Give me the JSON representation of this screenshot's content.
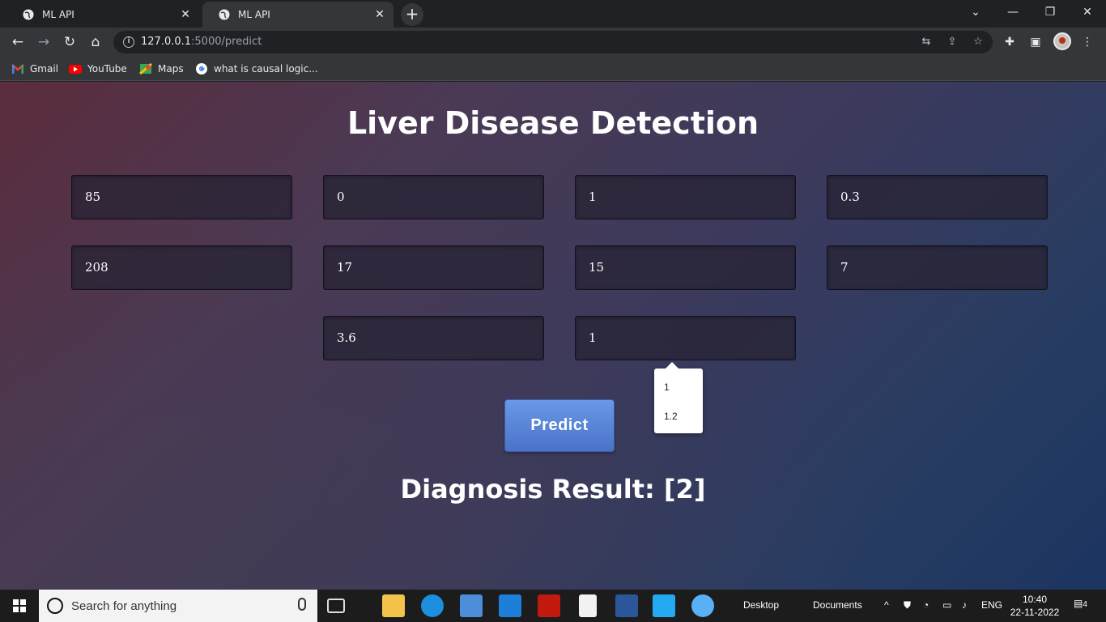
{
  "browser": {
    "tabs": [
      {
        "label": "ML API",
        "active": false
      },
      {
        "label": "ML API",
        "active": true
      }
    ],
    "url_host": "127.0.0.1",
    "url_path": ":5000/predict",
    "bookmarks": [
      {
        "label": "Gmail",
        "icon": "gmail-icon"
      },
      {
        "label": "YouTube",
        "icon": "youtube-icon"
      },
      {
        "label": "Maps",
        "icon": "maps-icon"
      },
      {
        "label": "what is causal logic...",
        "icon": "google-icon"
      }
    ]
  },
  "page": {
    "title": "Liver Disease Detection",
    "fields": [
      "85",
      "0",
      "1",
      "0.3",
      "208",
      "17",
      "15",
      "7",
      "3.6",
      "1"
    ],
    "autocomplete_options": [
      "1",
      "1.2"
    ],
    "predict_label": "Predict",
    "result_text": "Diagnosis Result: [2]"
  },
  "taskbar": {
    "search_placeholder": "Search for anything",
    "toolbar_desktop": "Desktop",
    "toolbar_documents": "Documents",
    "language": "ENG",
    "time": "10:40",
    "date": "22-11-2022",
    "notification_count": "4"
  },
  "colors": {
    "predict_button": "#5585dc",
    "page_gradient_start": "#5b2c3c",
    "page_gradient_end": "#1b3561"
  }
}
